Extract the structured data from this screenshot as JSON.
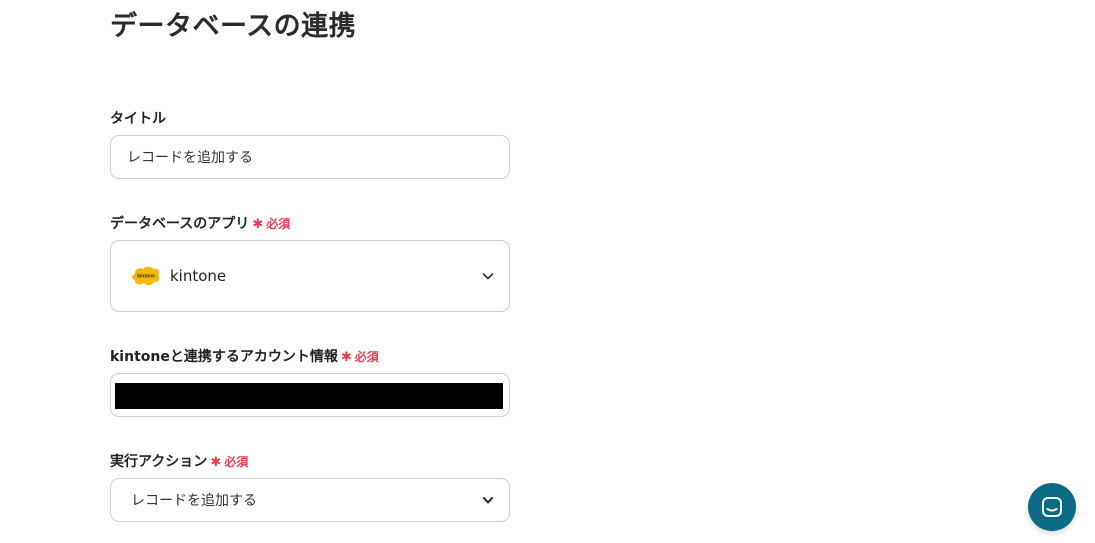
{
  "page": {
    "title": "データベースの連携"
  },
  "fields": {
    "title": {
      "label": "タイトル",
      "value": "レコードを追加する"
    },
    "database_app": {
      "label": "データベースのアプリ",
      "required_label": "必須",
      "selected_app": "kintone",
      "logo_text": "kintone",
      "logo_color": "#f5b800",
      "dropdown_icon": "chevron-down-icon"
    },
    "account": {
      "label": "kintoneと連携するアカウント情報",
      "required_label": "必須",
      "value_redacted": true
    },
    "action": {
      "label": "実行アクション",
      "required_label": "必須",
      "selected": "レコードを追加する",
      "dropdown_icon": "chevron-down-icon"
    }
  },
  "chat_widget": {
    "icon": "chat-icon",
    "color": "#0b6b84"
  },
  "colors": {
    "required": "#e53e52",
    "border": "#cfcfcf"
  }
}
